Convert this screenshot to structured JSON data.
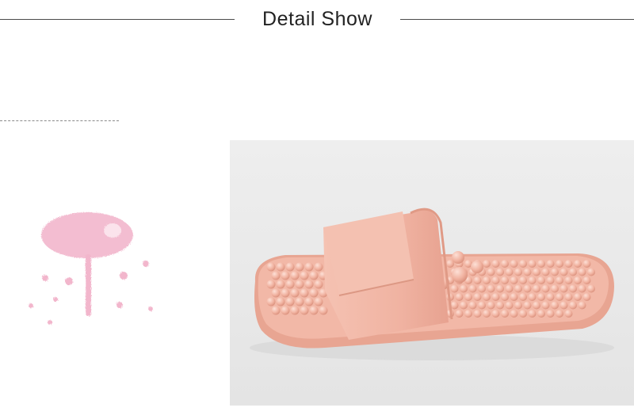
{
  "header": {
    "title": "Detail Show"
  },
  "colors": {
    "slipper": "#f0b4a4",
    "slipper_shadow": "#e29c8a",
    "photo_background": "#ececec",
    "stamp_pink": "#f2b6cc"
  },
  "icons": {
    "decoration": "pink-flower-stamp-icon",
    "product": "massage-slipper-photo"
  }
}
